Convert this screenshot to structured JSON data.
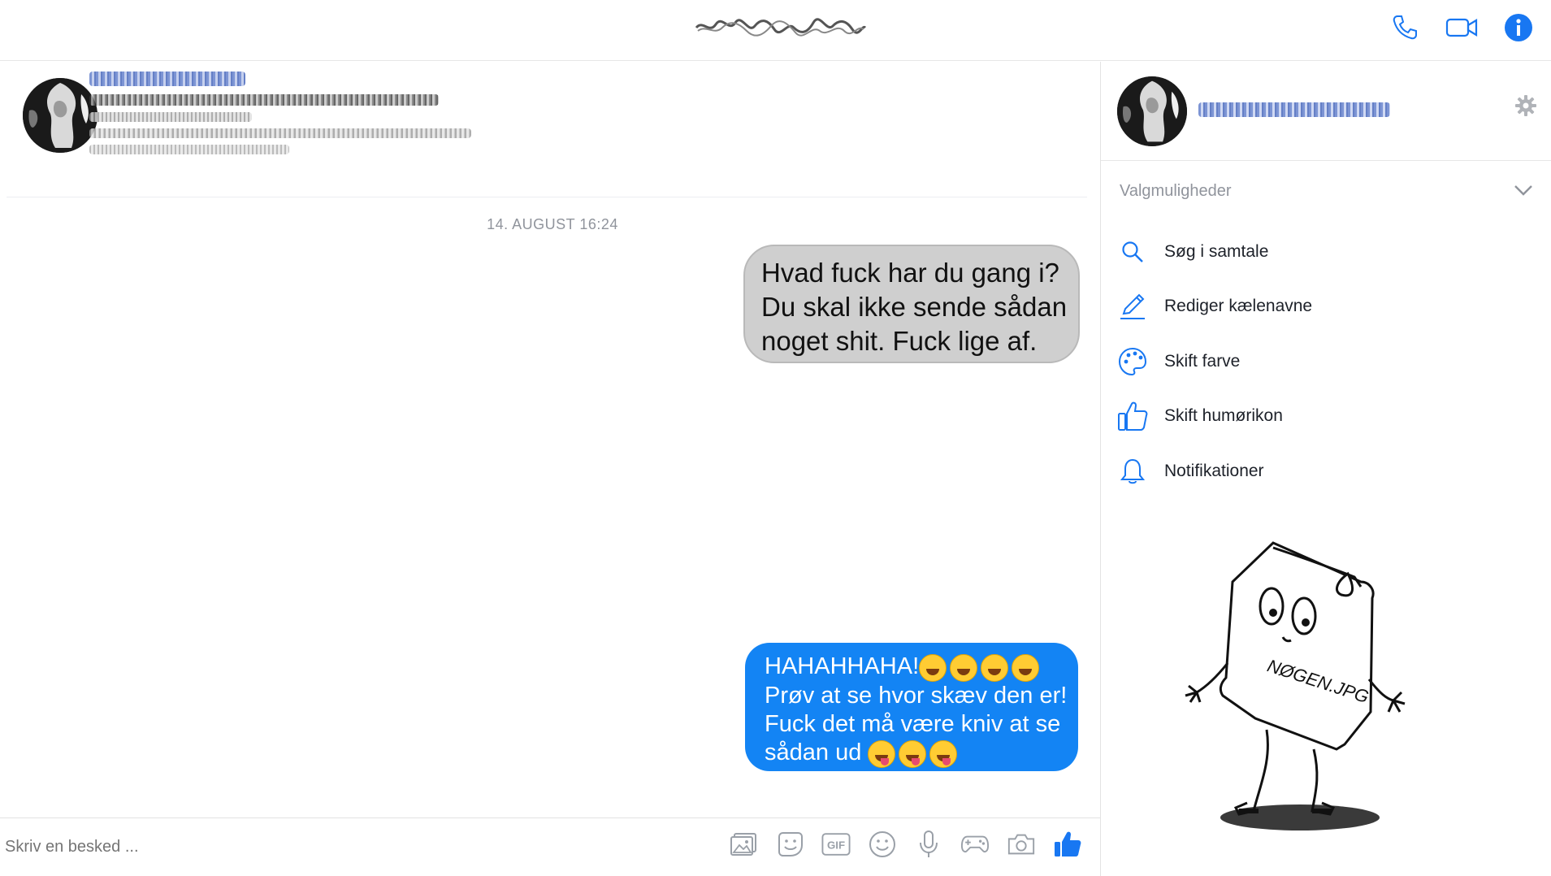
{
  "header": {
    "call_icon": "phone-icon",
    "video_icon": "video-camera-icon",
    "info_icon": "info-icon",
    "accent": "#1877f2"
  },
  "conversation": {
    "timestamp": "14. AUGUST 16:24",
    "messages": [
      {
        "style": "grey",
        "lines": [
          "Hvad fuck har du gang i?",
          "Du skal ikke sende sådan",
          "noget shit. Fuck lige af."
        ]
      },
      {
        "style": "blue",
        "lines": [
          "HAHAHHAHA!",
          "Prøv at se hvor skæv den er!",
          "Fuck det må være kniv at se",
          "sådan ud"
        ],
        "emojis": [
          "face-with-tears-of-joy",
          "face-with-tongue-wink"
        ]
      }
    ]
  },
  "composer": {
    "placeholder": "Skriv en besked ...",
    "tools": [
      "photo-icon",
      "sticker-icon",
      "gif-icon",
      "emoji-icon",
      "microphone-icon",
      "game-controller-icon",
      "camera-icon",
      "thumbs-up-icon"
    ],
    "gif_label": "GIF"
  },
  "side_panel": {
    "options_header": "Valgmuligheder",
    "items": [
      {
        "label": "Søg i samtale",
        "icon": "search-icon"
      },
      {
        "label": "Rediger kælenavne",
        "icon": "pencil-icon"
      },
      {
        "label": "Skift farve",
        "icon": "palette-icon"
      },
      {
        "label": "Skift humørikon",
        "icon": "thumbs-up-icon"
      },
      {
        "label": "Notifikationer",
        "icon": "bell-icon"
      }
    ],
    "mascot_label": "NØGEN.JPG"
  },
  "colors": {
    "blue_bubble": "#1384f4",
    "grey_bubble": "#cfcfcf",
    "icon_blue": "#1877f2"
  }
}
